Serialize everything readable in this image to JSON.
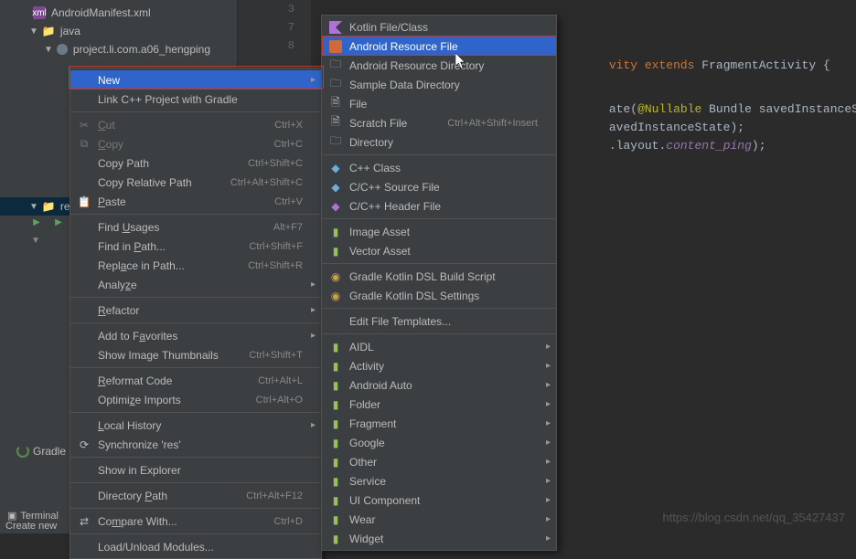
{
  "tree": {
    "manifest": "AndroidManifest.xml",
    "java": "java",
    "pkg": "project.li.com.a06_hengping",
    "res": "res"
  },
  "gutter_lines": [
    "3",
    "7",
    "8"
  ],
  "code": {
    "line1_kw1": "vity ",
    "line1_kw2": "extends ",
    "line1_cls": "FragmentActivity {",
    "line2_a": "ate(",
    "line2_ann": "@Nullable ",
    "line2_b": "Bundle savedInstanceSta",
    "line3": "avedInstanceState);",
    "line4_a": ".layout.",
    "line4_b": "content_ping",
    "line4_c": ");"
  },
  "context_menu": {
    "new": "New",
    "link_cpp": "Link C++ Project with Gradle",
    "cut": "Cut",
    "cut_s": "Ctrl+X",
    "copy": "Copy",
    "copy_s": "Ctrl+C",
    "copy_path": "Copy Path",
    "copy_path_s": "Ctrl+Shift+C",
    "copy_rel": "Copy Relative Path",
    "copy_rel_s": "Ctrl+Alt+Shift+C",
    "paste": "Paste",
    "paste_s": "Ctrl+V",
    "find_usages": "Find Usages",
    "find_usages_s": "Alt+F7",
    "find_in_path": "Find in Path...",
    "find_in_path_s": "Ctrl+Shift+F",
    "replace_in_path": "Replace in Path...",
    "replace_in_path_s": "Ctrl+Shift+R",
    "analyze": "Analyze",
    "refactor": "Refactor",
    "fav": "Add to Favorites",
    "thumbs": "Show Image Thumbnails",
    "thumbs_s": "Ctrl+Shift+T",
    "reformat": "Reformat Code",
    "reformat_s": "Ctrl+Alt+L",
    "optimize": "Optimize Imports",
    "optimize_s": "Ctrl+Alt+O",
    "local_hist": "Local History",
    "sync": "Synchronize 'res'",
    "explorer": "Show in Explorer",
    "dir_path": "Directory Path",
    "dir_path_s": "Ctrl+Alt+F12",
    "compare": "Compare With...",
    "compare_s": "Ctrl+D",
    "load_unload": "Load/Unload Modules..."
  },
  "new_menu": {
    "kotlin": "Kotlin File/Class",
    "ar_file": "Android Resource File",
    "ar_dir": "Android Resource Directory",
    "sample": "Sample Data Directory",
    "file": "File",
    "scratch": "Scratch File",
    "scratch_s": "Ctrl+Alt+Shift+Insert",
    "directory": "Directory",
    "cpp_class": "C++ Class",
    "cpp_source": "C/C++ Source File",
    "cpp_header": "C/C++ Header File",
    "image": "Image Asset",
    "vector": "Vector Asset",
    "gkdsl_build": "Gradle Kotlin DSL Build Script",
    "gkdsl_settings": "Gradle Kotlin DSL Settings",
    "edit_tmpl": "Edit File Templates...",
    "aidl": "AIDL",
    "activity": "Activity",
    "auto": "Android Auto",
    "folder": "Folder",
    "fragment": "Fragment",
    "google": "Google",
    "other": "Other",
    "service": "Service",
    "uicomp": "UI Component",
    "wear": "Wear",
    "widget": "Widget"
  },
  "bottom": {
    "terminal": "Terminal",
    "status": "Create new",
    "gradle": "Gradle"
  },
  "watermark": "https://blog.csdn.net/qq_35427437"
}
